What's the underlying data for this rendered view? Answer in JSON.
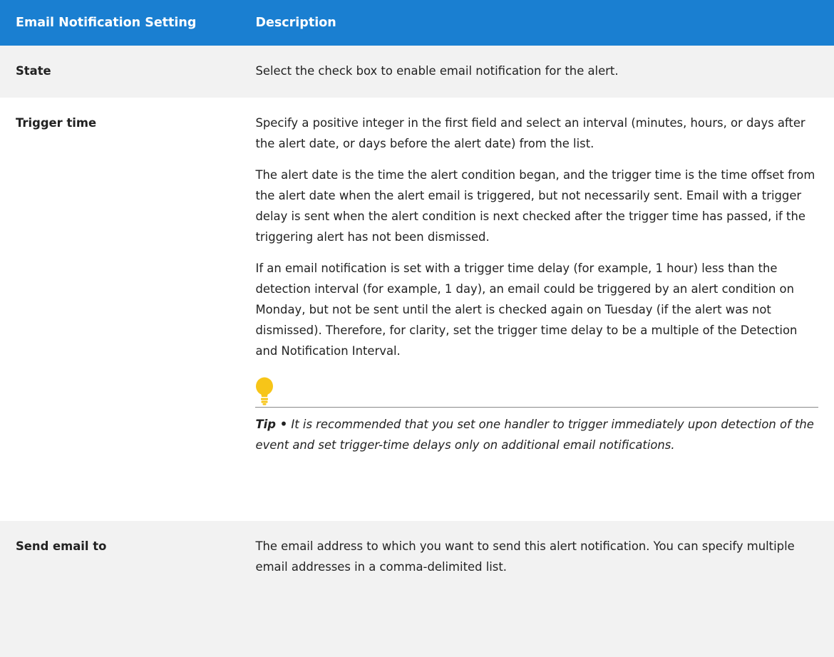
{
  "table": {
    "headers": {
      "setting": "Email Notification Setting",
      "description": "Description"
    },
    "rows": [
      {
        "name": "State",
        "paragraphs": [
          "Select the check box to enable email notification for the alert."
        ]
      },
      {
        "name": "Trigger time",
        "paragraphs": [
          "Specify a positive integer in the first field and select an interval (minutes, hours, or days after the alert date, or days before the alert date) from the list.",
          "The alert date is the time the alert condition began, and the trigger time is the time offset from the alert date when the alert email is triggered, but not necessarily sent. Email with a trigger delay is sent when the alert condition is next checked after the trigger time has passed, if the triggering alert has not been dismissed.",
          "If an email notification is set with a trigger time delay (for example, 1 hour) less than the detection interval (for example, 1 day), an email could be triggered by an alert condition on Monday, but not be sent until the alert is checked again on Tuesday (if the alert was not dismissed). Therefore, for clarity, set the trigger time delay to be a multiple of the Detection and Notification Interval."
        ],
        "tip": {
          "icon": "lightbulb-icon",
          "label": "Tip •",
          "text": " It is recommended that you set one handler to trigger immediately upon detection of the event and set trigger-time delays only on additional email notifications."
        }
      },
      {
        "name": "Send email to",
        "paragraphs": [
          "The email address to which you want to send this alert notification. You can specify multiple email addresses in a comma-delimited list."
        ]
      }
    ]
  },
  "colors": {
    "header_background": "#1a7fd1",
    "header_text": "#ffffff",
    "row_shaded": "#f2f2f2",
    "bulb_yellow": "#f7c518",
    "bulb_base": "#f7c518"
  }
}
